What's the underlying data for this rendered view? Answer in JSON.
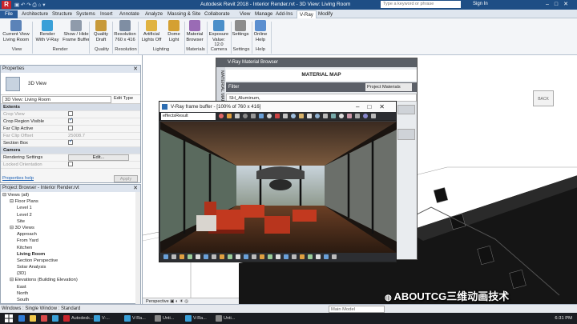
{
  "titlebar": {
    "app_title": "Autodesk Revit 2018 -   Interior Render.rvt - 3D View: Living Room",
    "search_placeholder": "Type a keyword or phrase",
    "signin": "Sign In",
    "logo": "R"
  },
  "tabs": [
    "File",
    "Architecture",
    "Structure",
    "Systems",
    "Insert",
    "Annotate",
    "Analyze",
    "Massing & Site",
    "Collaborate",
    "View",
    "Manage",
    "Add-Ins",
    "V-Ray",
    "Modify"
  ],
  "ribbon": {
    "buttons": [
      {
        "label": "Current View\nLiving Room",
        "color": "#5b83b8"
      },
      {
        "label": "Render\nWith V-Ray",
        "color": "#3aa0d8"
      },
      {
        "label": "Show / Hide\nFrame Buffer",
        "color": "#8f9bab"
      },
      {
        "label": "Quality\nDraft",
        "color": "#c89a3a"
      },
      {
        "label": "Resolution\n760 x 416",
        "color": "#7f8ea3"
      },
      {
        "label": "Artificial\nLights Off",
        "color": "#e0b341"
      },
      {
        "label": "Dome\nLight",
        "color": "#d4a032"
      },
      {
        "label": "Material\nBrowser",
        "color": "#9a6bb5"
      },
      {
        "label": "Exposure\nValue: 12.0",
        "color": "#4b8fc9"
      },
      {
        "label": "Settings",
        "color": "#8c8c8c"
      },
      {
        "label": "Online\nHelp",
        "color": "#5b8fd0"
      }
    ],
    "groups": [
      "View",
      "Render",
      "Quality",
      "Resolution",
      "Lighting",
      "Materials",
      "Camera",
      "Settings",
      "Help"
    ]
  },
  "properties": {
    "title": "Properties",
    "type_name": "3D View",
    "selector": "3D View: Living Room",
    "edit_type": "Edit Type",
    "rows": [
      {
        "label": "Extents",
        "section": true
      },
      {
        "label": "Crop View",
        "check": false,
        "dim": true
      },
      {
        "label": "Crop Region Visible",
        "check": true
      },
      {
        "label": "Far Clip Active",
        "check": false
      },
      {
        "label": "Far Clip Offset",
        "value": "25008.7",
        "dim": true
      },
      {
        "label": "Section Box",
        "check": true
      },
      {
        "label": "Camera",
        "section": true
      },
      {
        "label": "Rendering Settings",
        "value": "Edit..."
      },
      {
        "label": "Locked Orientation",
        "check": false,
        "dim": true
      }
    ],
    "help_link": "Properties help",
    "apply": "Apply"
  },
  "project_browser": {
    "title": "Project Browser - Interior Render.rvt",
    "items": [
      {
        "label": "Views (all)",
        "level": 0,
        "exp": "⊟"
      },
      {
        "label": "Floor Plans",
        "level": 1,
        "exp": "⊟"
      },
      {
        "label": "Level 1",
        "level": 2
      },
      {
        "label": "Level 2",
        "level": 2
      },
      {
        "label": "Site",
        "level": 2
      },
      {
        "label": "3D Views",
        "level": 1,
        "exp": "⊟"
      },
      {
        "label": "Approach",
        "level": 2
      },
      {
        "label": "From Yard",
        "level": 2
      },
      {
        "label": "Kitchen",
        "level": 2
      },
      {
        "label": "Living Room",
        "level": 2,
        "bold": true
      },
      {
        "label": "Section Perspective",
        "level": 2
      },
      {
        "label": "Solar Analysis",
        "level": 2
      },
      {
        "label": "{3D}",
        "level": 2
      },
      {
        "label": "Elevations (Building Elevation)",
        "level": 1,
        "exp": "⊟"
      },
      {
        "label": "East",
        "level": 2
      },
      {
        "label": "North",
        "level": 2
      },
      {
        "label": "South",
        "level": 2
      }
    ]
  },
  "material_editor": {
    "title": "V-Ray Material Browser",
    "header": "MATERIAL MAP",
    "side_label": "MATERIAL MAP",
    "filter_label": "Filter",
    "filter_value": "Project Materials",
    "name_value": "SH_Aluminum,"
  },
  "frame_buffer": {
    "title": "V-Ray frame buffer - [100% of 760 x 416]",
    "channel": "effectsResult"
  },
  "viewport": {
    "viewcube": "BACK",
    "mode": "Perspective"
  },
  "statusbar": {
    "text": "Windows : Single Window : Standard",
    "model": "Main Model"
  },
  "taskbar": {
    "items": [
      {
        "label": "",
        "color": "#2f7bd6"
      },
      {
        "label": "",
        "color": "#f2c94c"
      },
      {
        "label": "",
        "color": "#d94a4a"
      },
      {
        "label": "",
        "color": "#3aa0d8"
      },
      {
        "label": "Autodesk...",
        "color": "#c9242b"
      },
      {
        "label": "V-...",
        "color": "#3aa0d8"
      },
      {
        "label": "V-Ra...",
        "color": "#3aa0d8"
      },
      {
        "label": "Unti...",
        "color": "#888"
      },
      {
        "label": "V-Ra...",
        "color": "#3aa0d8"
      },
      {
        "label": "Unti...",
        "color": "#888"
      }
    ],
    "clock": "6:31 PM"
  },
  "watermark": "ABOUTCG三维动画技术"
}
